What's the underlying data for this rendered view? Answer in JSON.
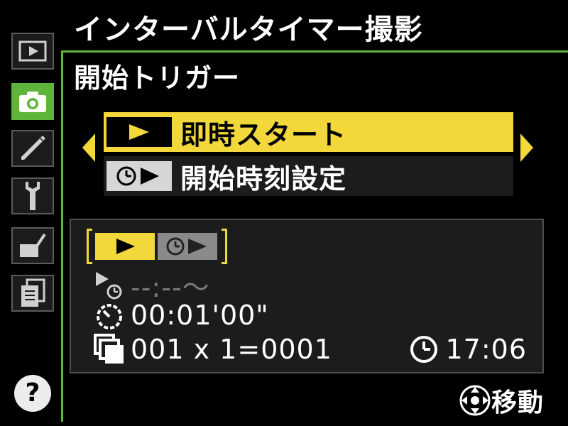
{
  "screen": {
    "title": "インターバルタイマー撮影",
    "subtitle": "開始トリガー"
  },
  "sidebar": {
    "tabs": [
      {
        "icon": "playback-icon",
        "active": false
      },
      {
        "icon": "camera-icon",
        "active": true
      },
      {
        "icon": "pencil-icon",
        "active": false
      },
      {
        "icon": "wrench-icon",
        "active": false
      },
      {
        "icon": "retouch-icon",
        "active": false
      },
      {
        "icon": "my-menu-icon",
        "active": false
      }
    ],
    "help_label": "?"
  },
  "options": [
    {
      "icon": "play-icon",
      "label": "即時スタート",
      "selected": true
    },
    {
      "icon": "clock-play-icon",
      "label": "開始時刻設定",
      "selected": false
    }
  ],
  "info": {
    "start_time": "--:--～",
    "interval": "00:01'00\"",
    "shots": "001 x 1=0001",
    "clock": "17:06"
  },
  "hint": {
    "icon": "multi-selector-icon",
    "label": "移動"
  },
  "colors": {
    "accent_yellow": "#f2d83a",
    "active_green": "#5fb53c",
    "panel_bg": "#1c1c1c"
  }
}
